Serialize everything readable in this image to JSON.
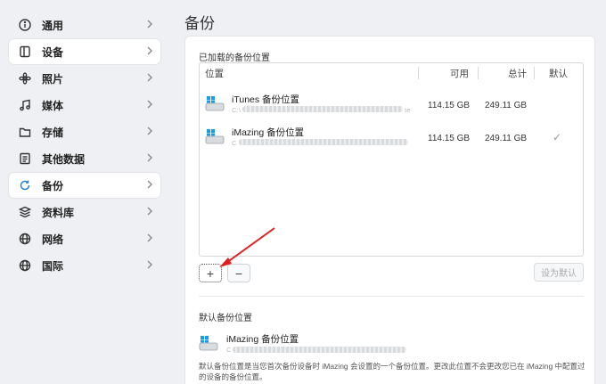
{
  "sidebar": {
    "items": [
      {
        "label": "通用",
        "icon": "info-icon"
      },
      {
        "label": "设备",
        "icon": "device-icon"
      },
      {
        "label": "照片",
        "icon": "photos-icon"
      },
      {
        "label": "媒体",
        "icon": "music-icon"
      },
      {
        "label": "存储",
        "icon": "folder-icon"
      },
      {
        "label": "其他数据",
        "icon": "document-icon"
      },
      {
        "label": "备份",
        "icon": "backup-icon"
      },
      {
        "label": "资料库",
        "icon": "library-icon"
      },
      {
        "label": "网络",
        "icon": "globe-icon"
      },
      {
        "label": "国际",
        "icon": "globe-icon"
      }
    ],
    "selected": [
      "设备",
      "备份"
    ]
  },
  "page": {
    "title": "备份",
    "loaded_label": "已加载的备份位置",
    "default_label": "默认备份位置"
  },
  "table": {
    "columns": {
      "location": "位置",
      "available": "可用",
      "total": "总计",
      "default": "默认"
    },
    "rows": [
      {
        "name": "iTunes 备份位置",
        "path": "C:\\",
        "path_tail": "te",
        "available": "114.15 GB",
        "total": "249.11 GB",
        "default": ""
      },
      {
        "name": "iMazing 备份位置",
        "path": "C",
        "path_tail": "",
        "available": "114.15 GB",
        "total": "249.11 GB",
        "default": "✓"
      }
    ]
  },
  "buttons": {
    "add": "+",
    "remove": "−",
    "set_default": "设为默认"
  },
  "default_location": {
    "name": "iMazing 备份位置",
    "path": "C",
    "description": "默认备份位置是当您首次备份设备时 iMazing 会设置的一个备份位置。更改此位置不会更改您已在 iMazing 中配置过的设备的备份位置。"
  },
  "colors": {
    "annotation_arrow": "#e02020",
    "drive_blue": "#1a9be8"
  }
}
